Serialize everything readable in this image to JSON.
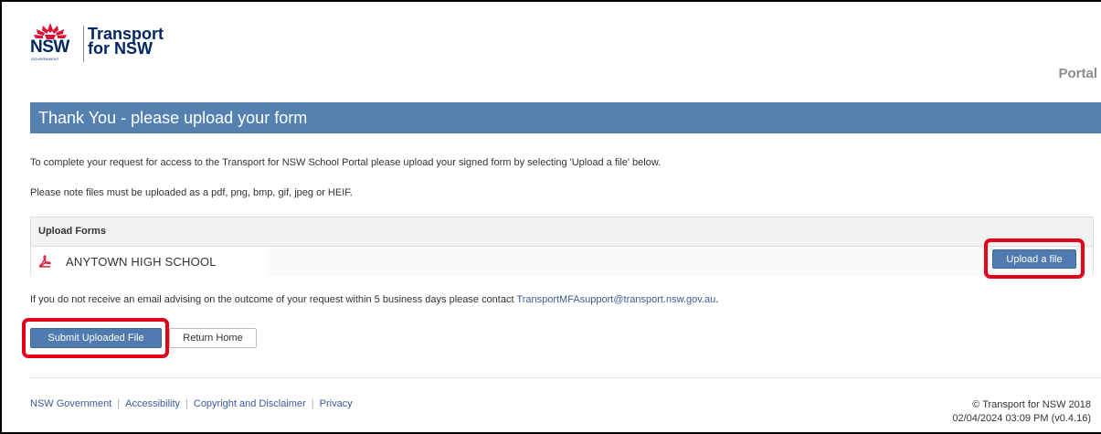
{
  "brand": {
    "nsw_mark": "NSW",
    "government_mark": "GOVERNMENT",
    "transport_line1": "Transport",
    "transport_line2": "for NSW",
    "portal_label": "Portal"
  },
  "page": {
    "title": "Thank You - please upload your form",
    "instruction": "To complete your request for access to the Transport for NSW School Portal please upload your signed form by selecting 'Upload a file' below.",
    "file_types_note": "Please note files must be uploaded as a pdf, png, bmp, gif, jpeg or HEIF."
  },
  "upload_panel": {
    "heading": "Upload Forms",
    "file_name": "ANYTOWN HIGH SCHOOL",
    "file_icon": "pdf-icon",
    "upload_label": "Upload a file"
  },
  "contact": {
    "text": "If you do not receive an email advising on the outcome of your request within 5 business days please contact ",
    "email": "TransportMFAsupport@transport.nsw.gov.au",
    "suffix": "."
  },
  "actions": {
    "submit_label": "Submit Uploaded File",
    "return_label": "Return Home"
  },
  "footer": {
    "links": [
      "NSW Government",
      "Accessibility",
      "Copyright and Disclaimer",
      "Privacy"
    ],
    "separator": "|",
    "copyright": "© Transport for NSW 2018",
    "timestamp": "02/04/2024 03:09 PM (v0.4.16)"
  },
  "colors": {
    "title_bar": "#5581b0",
    "primary_button": "#4f7bb0",
    "link": "#3c5a99",
    "highlight": "#e3001b",
    "brand_navy": "#002664",
    "brand_red": "#d7153a"
  }
}
